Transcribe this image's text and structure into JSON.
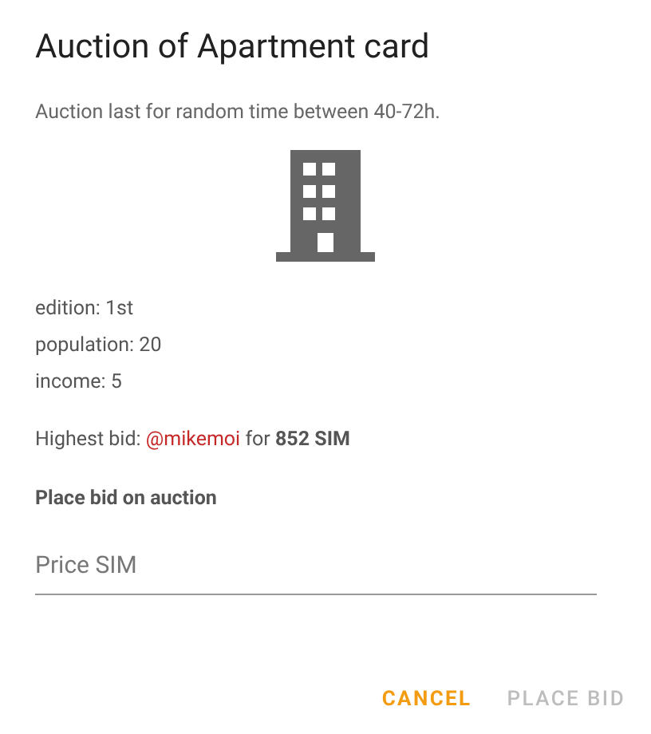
{
  "dialog": {
    "title": "Auction of Apartment card",
    "subtitle": "Auction last for random time between 40-72h.",
    "details": [
      "edition: 1st",
      "population: 20",
      "income: 5"
    ],
    "highest_bid": {
      "label": "Highest bid:",
      "user": "@mikemoi",
      "rest": "for **852 SIM**"
    },
    "bid_heading": "Place bid on auction",
    "price_field": {
      "placeholder": "Price SIM"
    },
    "buttons": [
      {
        "label": "CANCEL",
        "disabled": false
      },
      {
        "label": "PLACE BID",
        "disabled": true
      }
    ]
  }
}
